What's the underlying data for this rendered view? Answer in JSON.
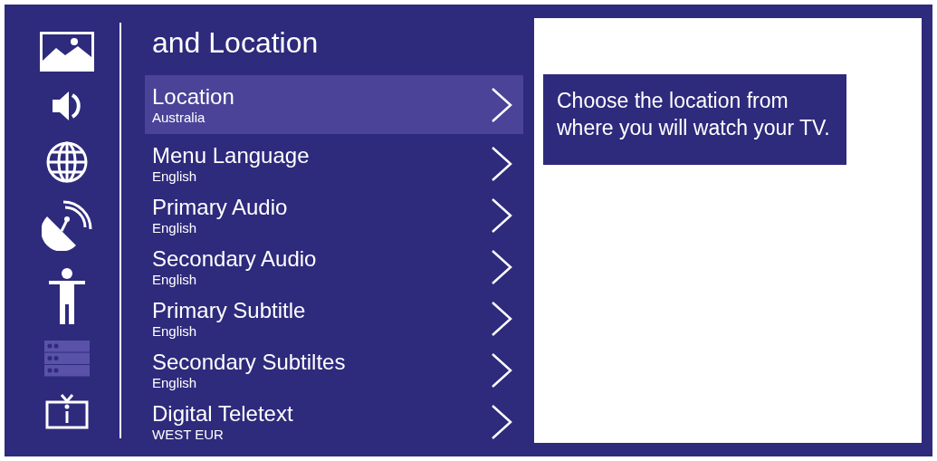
{
  "sidebar": {
    "items": [
      {
        "kind": "picture",
        "selected": false
      },
      {
        "kind": "sound",
        "selected": false
      },
      {
        "kind": "globe",
        "selected": false
      },
      {
        "kind": "satellite",
        "selected": false
      },
      {
        "kind": "person",
        "selected": false
      },
      {
        "kind": "list",
        "selected": true
      },
      {
        "kind": "tv",
        "selected": false
      }
    ]
  },
  "menu": {
    "title": "and Location",
    "items": [
      {
        "label": "Location",
        "value": "Australia",
        "selected": true
      },
      {
        "label": "Menu Language",
        "value": "English",
        "selected": false
      },
      {
        "label": "Primary Audio",
        "value": "English",
        "selected": false
      },
      {
        "label": "Secondary Audio",
        "value": "English",
        "selected": false
      },
      {
        "label": "Primary Subtitle",
        "value": "English",
        "selected": false
      },
      {
        "label": "Secondary Subtiltes",
        "value": "English",
        "selected": false
      },
      {
        "label": "Digital Teletext",
        "value": "WEST EUR",
        "selected": false
      }
    ]
  },
  "help": {
    "text": "Choose the location from where you will watch your TV."
  }
}
